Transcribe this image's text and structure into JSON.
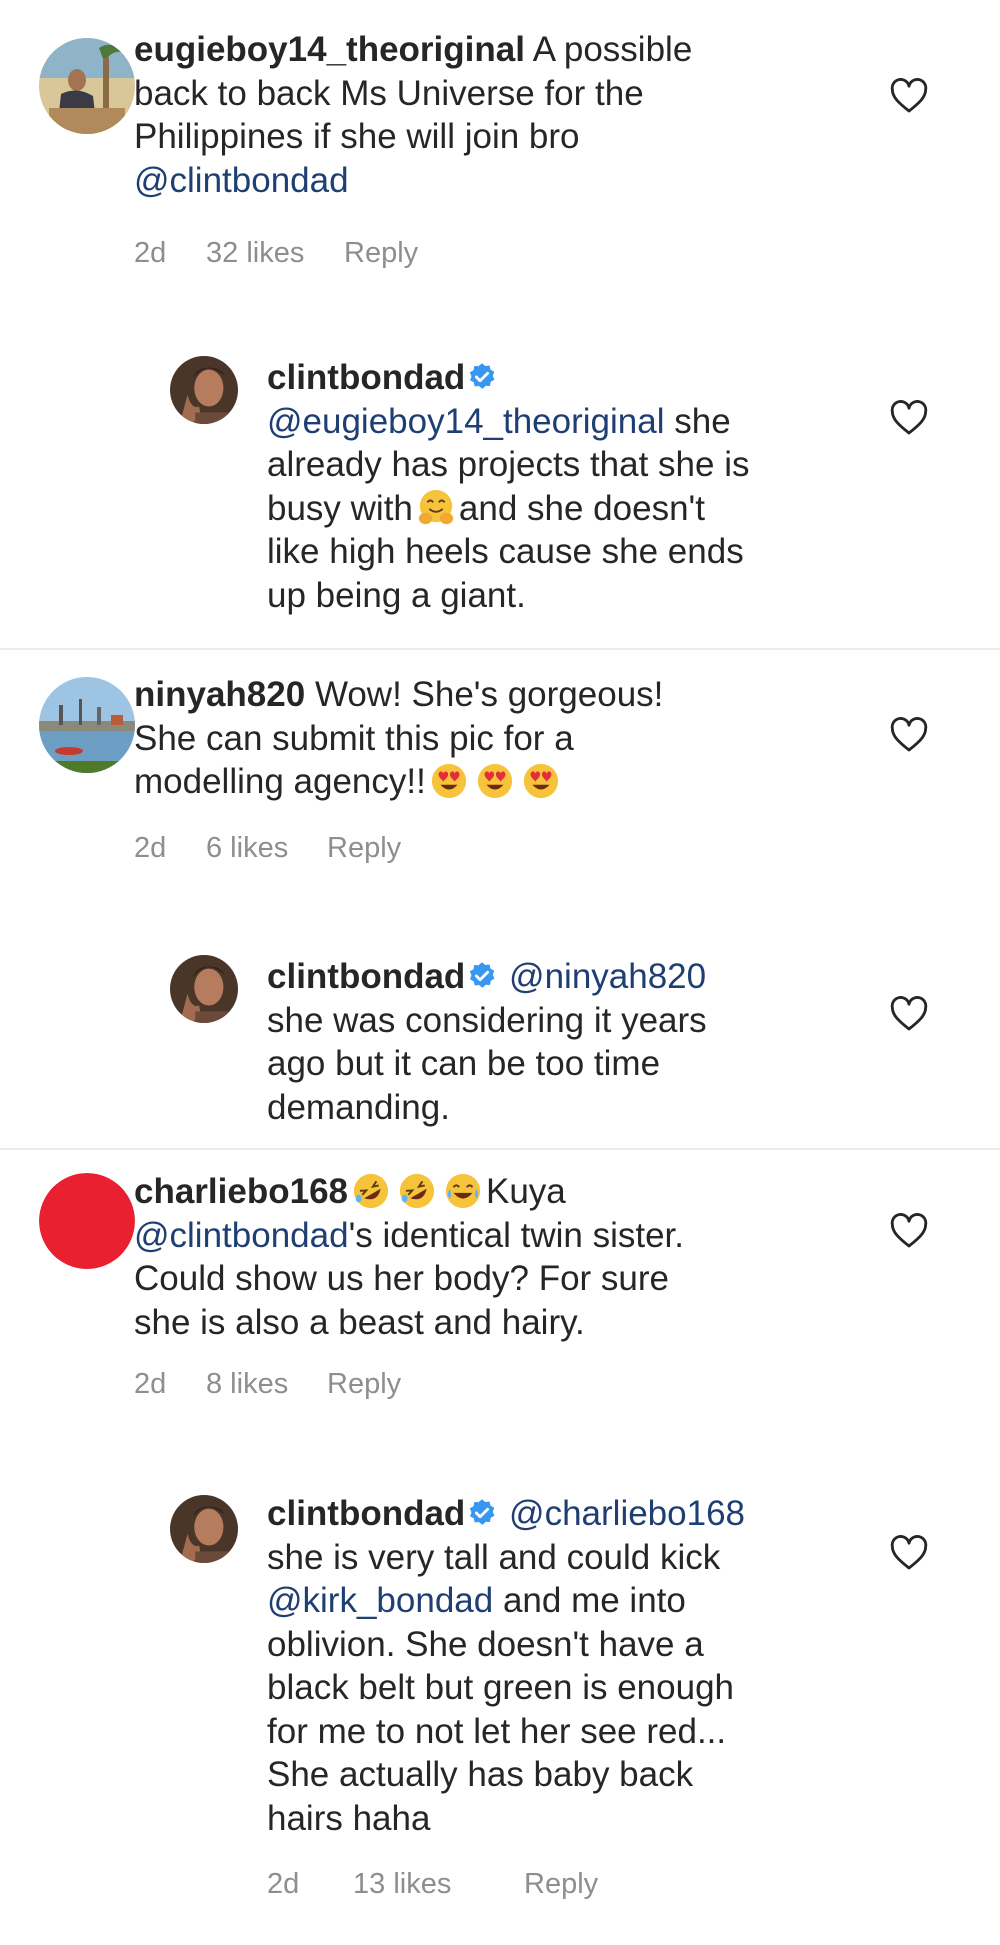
{
  "comments": [
    {
      "username": "eugieboy14_theoriginal",
      "text_1": "A possible",
      "text_2": "back to back Ms Universe for the",
      "text_3": "Philippines if she will join bro",
      "mention": "@clintbondad",
      "time": "2d",
      "likes": "32 likes",
      "reply": "Reply",
      "avatar": "avatar-photo-man-with-tree"
    },
    {
      "username": "clintbondad",
      "mention": "@eugieboy14_theoriginal",
      "text_1": "she",
      "text_2": "already has projects that she is",
      "text_3": "busy with",
      "text_4": "and she doesn't",
      "text_5": "like high heels cause she ends",
      "text_6": "up being a giant.",
      "emoji": "hugging-face-emoji"
    },
    {
      "username": "ninyah820",
      "text_1": "Wow! She's gorgeous!",
      "text_2": "She can submit this pic for a",
      "text_3": "modelling agency!!",
      "emojis": [
        "heart-eyes-emoji",
        "heart-eyes-emoji",
        "heart-eyes-emoji"
      ],
      "time": "2d",
      "likes": "6 likes",
      "reply": "Reply"
    },
    {
      "username": "clintbondad",
      "mention": "@ninyah820",
      "text_1": "she was considering it years",
      "text_2": "ago but it can be too time",
      "text_3": "demanding."
    },
    {
      "username": "charliebo168",
      "emojis": [
        "rolling-laughing-emoji",
        "rolling-laughing-emoji",
        "tears-of-joy-emoji"
      ],
      "text_1": "Kuya",
      "mention": "@clintbondad",
      "text_2": "'s identical twin sister.",
      "text_3": "Could show us her body? For sure",
      "text_4": "she is also a beast and hairy.",
      "time": "2d",
      "likes": "8 likes",
      "reply": "Reply",
      "avatar_color": "#e8202f"
    },
    {
      "username": "clintbondad",
      "mention": "@charliebo168",
      "text_1": "she is very tall and could kick",
      "mention_2": "@kirk_bondad",
      "text_2": "and me into",
      "text_3": "oblivion. She doesn't have a",
      "text_4": "black belt but green is enough",
      "text_5": "for me to not let her see red...",
      "text_6": "She actually has baby back",
      "text_7": "hairs haha",
      "time": "2d",
      "likes": "13 likes",
      "reply": "Reply"
    }
  ],
  "colors": {
    "mention": "#1f3f73",
    "verified": "#3897f0",
    "meta": "#8e8e8e",
    "heart_stroke": "#262626"
  }
}
